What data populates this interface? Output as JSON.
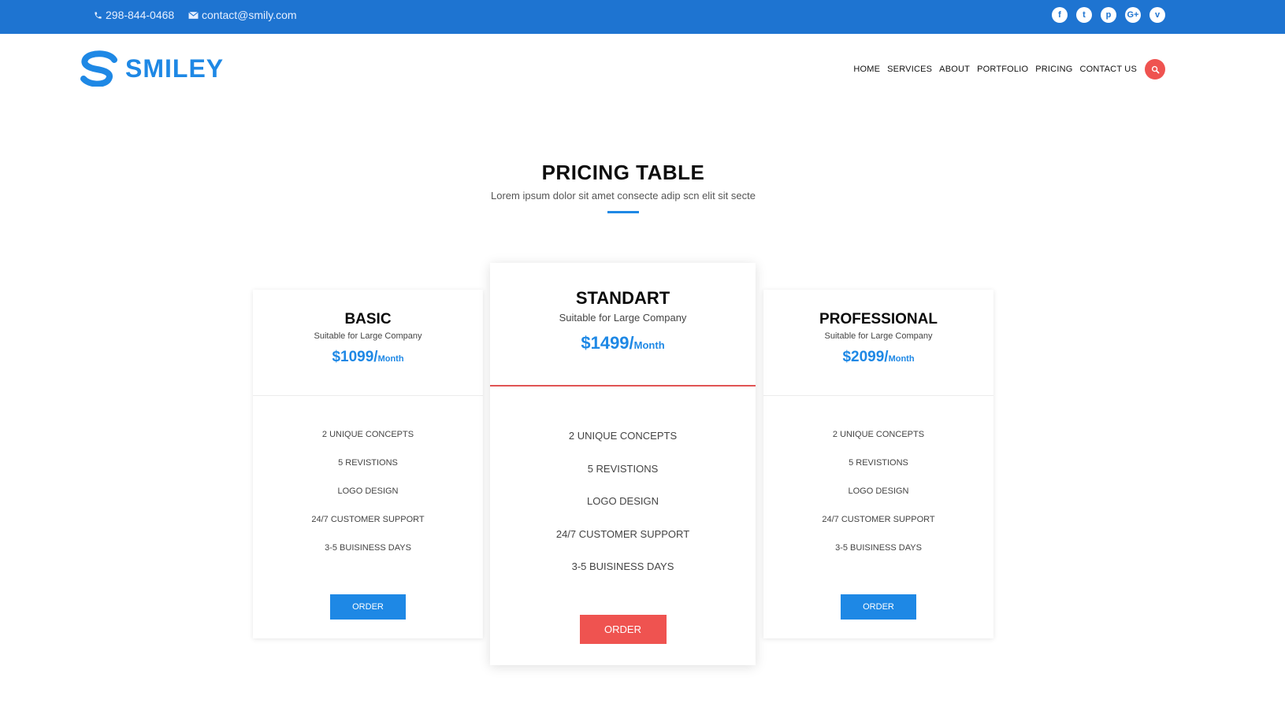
{
  "topbar": {
    "phone": "298-844-0468",
    "email": "contact@smily.com",
    "socials": [
      {
        "icon": "facebook-icon",
        "glyph": "f"
      },
      {
        "icon": "twitter-icon",
        "glyph": "t"
      },
      {
        "icon": "pinterest-icon",
        "glyph": "p"
      },
      {
        "icon": "google-plus-icon",
        "glyph": "G+"
      },
      {
        "icon": "vimeo-icon",
        "glyph": "v"
      }
    ]
  },
  "brand": {
    "name": "SMILEY",
    "color": "#1e88e5"
  },
  "nav": {
    "items": [
      "HOME",
      "SERVICES",
      "ABOUT",
      "PORTFOLIO",
      "PRICING",
      "CONTACT US"
    ],
    "search_icon": "search-icon"
  },
  "section": {
    "title": "PRICING TABLE",
    "subtitle": "Lorem ipsum dolor sit amet consecte adip scn elit sit secte"
  },
  "plans": [
    {
      "name": "BASIC",
      "desc": "Suitable for Large Company",
      "price": "$1099/",
      "period": "Month",
      "features": [
        "2 UNIQUE CONCEPTS",
        "5 REVISTIONS",
        "LOGO DESIGN",
        "24/7 CUSTOMER SUPPORT",
        "3-5 BUISINESS DAYS"
      ],
      "button": "ORDER"
    },
    {
      "name": "STANDART",
      "desc": "Suitable for Large Company",
      "price": "$1499/",
      "period": "Month",
      "features": [
        "2 UNIQUE CONCEPTS",
        "5 REVISTIONS",
        "LOGO DESIGN",
        "24/7 CUSTOMER SUPPORT",
        "3-5 BUISINESS DAYS"
      ],
      "button": "ORDER"
    },
    {
      "name": "PROFESSIONAL",
      "desc": "Suitable for Large Company",
      "price": "$2099/",
      "period": "Month",
      "features": [
        "2 UNIQUE CONCEPTS",
        "5 REVISTIONS",
        "LOGO DESIGN",
        "24/7 CUSTOMER SUPPORT",
        "3-5 BUISINESS DAYS"
      ],
      "button": "ORDER"
    }
  ],
  "colors": {
    "topbar": "#1e74d1",
    "accent_blue": "#1e88e5",
    "accent_red": "#ef5350"
  }
}
